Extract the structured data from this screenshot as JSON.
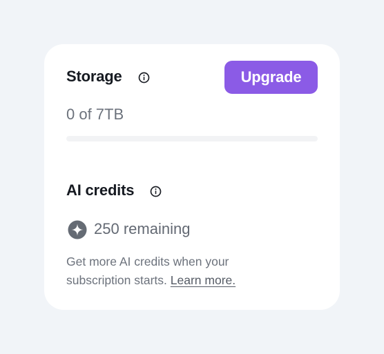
{
  "storage": {
    "title": "Storage",
    "upgrade_label": "Upgrade",
    "usage_text": "0 of 7TB",
    "used_fraction": 0
  },
  "ai_credits": {
    "title": "AI credits",
    "remaining_text": "250 remaining",
    "description": "Get more AI credits when your subscription starts.",
    "learn_more_label": "Learn more."
  },
  "colors": {
    "accent": "#8b5be6",
    "background": "#f1f4f8",
    "card": "#ffffff"
  },
  "icons": {
    "storage_info": "info-icon",
    "ai_info": "info-icon",
    "credits": "sparkle-icon"
  }
}
